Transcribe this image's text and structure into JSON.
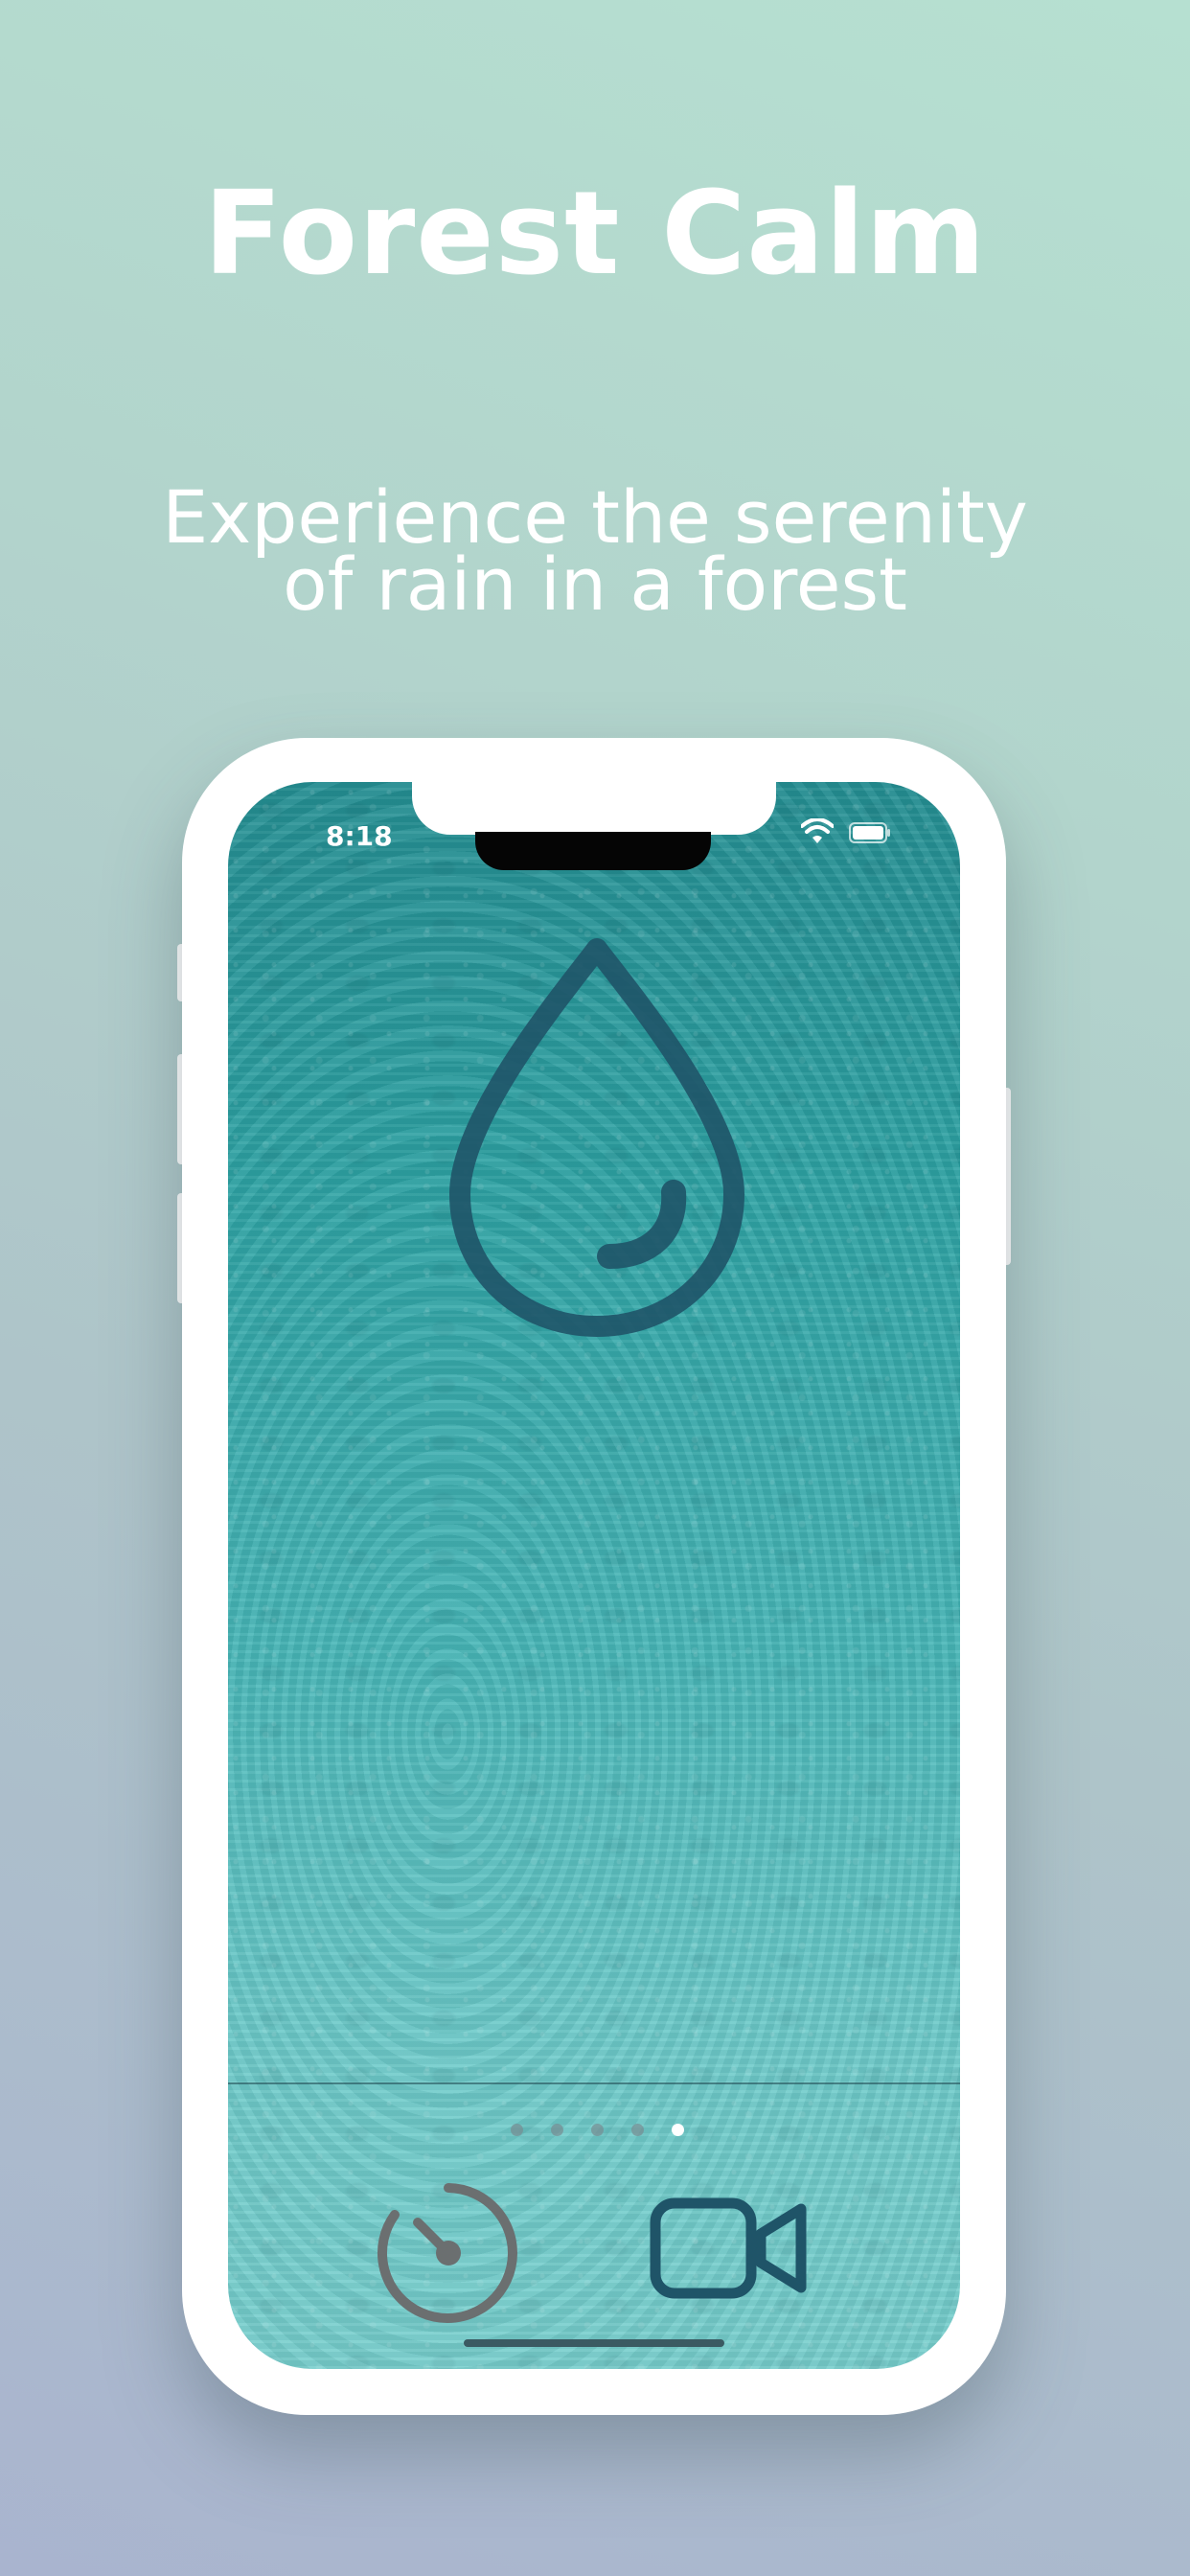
{
  "headline": "Forest Calm",
  "subheadline": {
    "line1": "Experience the serenity",
    "line2": "of rain in a forest"
  },
  "device": {
    "status_bar": {
      "time": "8:18",
      "wifi_icon": "wifi-icon",
      "battery_icon": "battery-icon"
    },
    "main_icon": "water-drop-icon",
    "page_indicator": {
      "count": 5,
      "active_index": 4
    },
    "bottom_bar": {
      "left_button_icon": "timer-icon",
      "right_button_icon": "video-camera-icon"
    }
  },
  "colors": {
    "background_top": "#b6e0d1",
    "background_bottom": "#a9b4cf",
    "icon_dark": "#1f5468",
    "timer_gray": "#6b6f70",
    "text": "#ffffff"
  }
}
